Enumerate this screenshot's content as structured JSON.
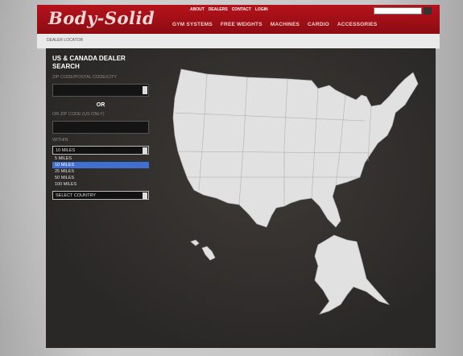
{
  "header": {
    "logo": "Body-Solid",
    "top_links": [
      "ABOUT",
      "DEALERS",
      "CONTACT",
      "LOGIN"
    ],
    "search_placeholder": "",
    "nav": [
      "GYM SYSTEMS",
      "FREE WEIGHTS",
      "MACHINES",
      "CARDIO",
      "ACCESSORIES"
    ]
  },
  "breadcrumb": "DEALER LOCATOR",
  "search_panel": {
    "title": "US & CANADA DEALER SEARCH",
    "zip_label": "ZIP CODE/POSTAL CODE/CITY",
    "or_label": "OR",
    "zip_code_label": "OR ZIP CODE (US ONLY)",
    "within_label": "WITHIN",
    "selected_radius": "10 MILES",
    "radius_options": [
      "5 MILES",
      "10 MILES",
      "25 MILES",
      "50 MILES",
      "100 MILES"
    ],
    "selected_radius_index": 1,
    "country_select": "SELECT COUNTRY"
  },
  "colors": {
    "header_red": "#b6121b",
    "map_fill": "#e1e1e1",
    "panel_bg": "#2e2c2a",
    "highlight": "#3e6fd1"
  }
}
